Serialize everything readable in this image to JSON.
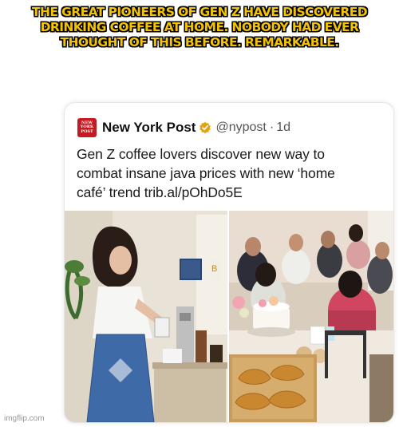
{
  "meme": {
    "caption_lines": [
      "THE GREAT PIONEERS OF GEN Z HAVE DISCOVERED",
      "DRINKING COFFEE AT HOME. NOBODY HAD EVER",
      "THOUGHT OF THIS BEFORE. REMARKABLE."
    ],
    "watermark": "imgflip.com"
  },
  "tweet": {
    "logo_text": "NEW YORK POST",
    "author_name": "New York Post",
    "handle": "@nypost",
    "separator": "·",
    "age": "1d",
    "text_lines": [
      "Gen Z coffee lovers discover new way to",
      "combat insane java prices with new ‘home",
      "café’ trend trib.al/pOhDo5E"
    ],
    "photo_left": "woman-pouring-coffee-icon",
    "photo_right": "friends-table-pastries-icon"
  },
  "colors": {
    "caption_fill": "#f4c400",
    "caption_outline": "#000000",
    "nyp_red": "#c41a22",
    "verified_gold": "#e2a30c"
  }
}
